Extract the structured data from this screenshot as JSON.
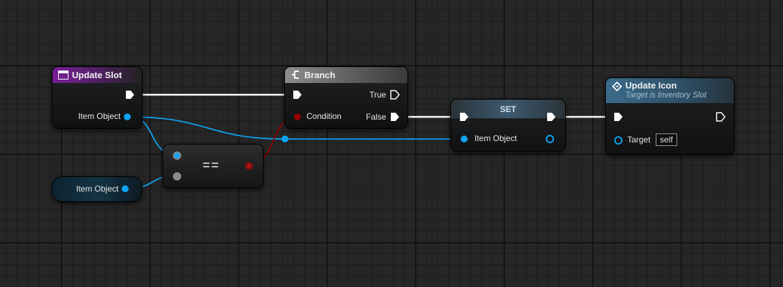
{
  "nodes": {
    "update_slot": {
      "title": "Update Slot",
      "item_object_label": "Item Object"
    },
    "item_object_getter": {
      "label": "Item Object"
    },
    "branch": {
      "title": "Branch",
      "true_label": "True",
      "condition_label": "Condition",
      "false_label": "False"
    },
    "equal": {
      "symbol": "=="
    },
    "set": {
      "title": "SET",
      "item_object_label": "Item Object"
    },
    "update_icon": {
      "title": "Update Icon",
      "subtitle": "Target is Inventory Slot",
      "target_label": "Target",
      "target_value": "self"
    }
  },
  "colors": {
    "exec_wire": "#ffffff",
    "object_wire": "#0da3f2",
    "bool_wire": "#930000",
    "event_header": "#7a1f9a",
    "function_header": "#3b6b8a"
  },
  "icons": {
    "update_slot": "event-icon",
    "branch": "branch-icon",
    "update_icon": "function-icon"
  }
}
